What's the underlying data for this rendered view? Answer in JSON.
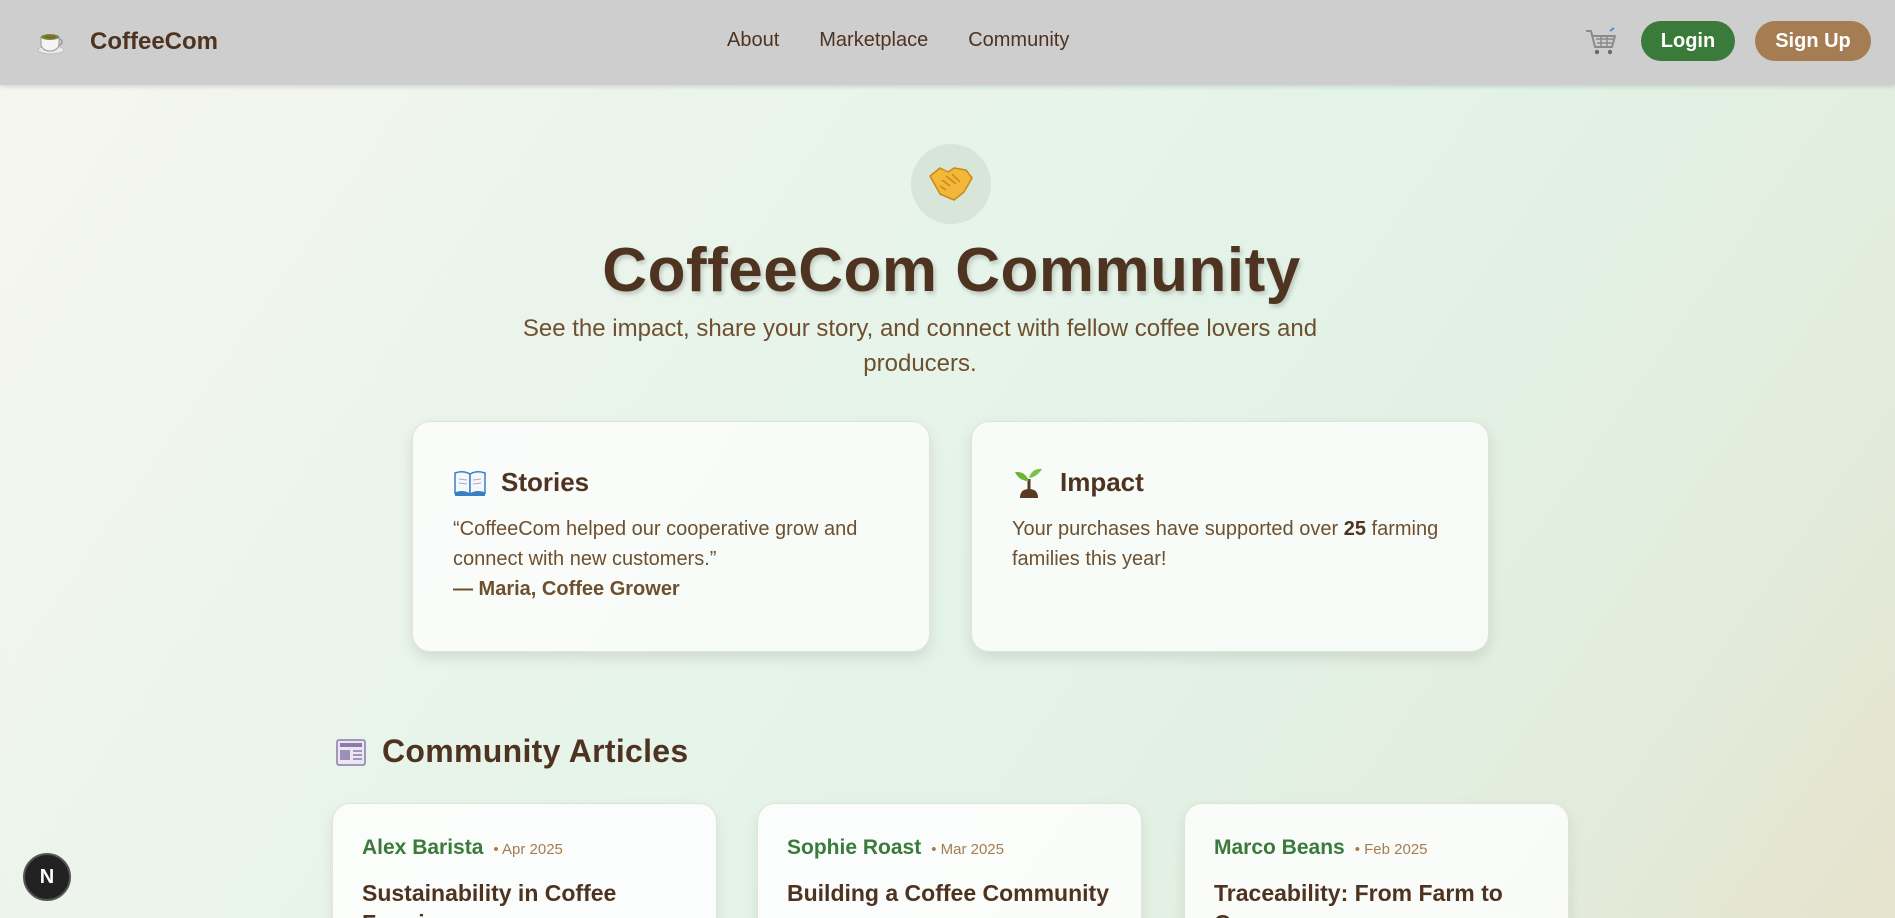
{
  "nav": {
    "brand": "CoffeeCom",
    "links": [
      "About",
      "Marketplace",
      "Community"
    ],
    "login": "Login",
    "signup": "Sign Up"
  },
  "hero": {
    "title": "CoffeeCom Community",
    "subtitle": "See the impact, share your story, and connect with fellow coffee lovers and producers."
  },
  "cards": {
    "stories": {
      "title": "Stories",
      "quote": "“CoffeeCom helped our cooperative grow and connect with new customers.”",
      "author": "— Maria, Coffee Grower"
    },
    "impact": {
      "title": "Impact",
      "text_before": "Your purchases have supported over ",
      "number": "25",
      "text_after": " farming families this year!"
    }
  },
  "articles": {
    "heading": "Community Articles",
    "items": [
      {
        "author": "Alex Barista",
        "date": "• Apr 2025",
        "title": "Sustainability in Coffee Farming"
      },
      {
        "author": "Sophie Roast",
        "date": "• Mar 2025",
        "title": "Building a Coffee Community"
      },
      {
        "author": "Marco Beans",
        "date": "• Feb 2025",
        "title": "Traceability: From Farm to Cup"
      }
    ]
  },
  "badge": {
    "letter": "N"
  },
  "icons": {
    "brand": "coffee-cup-icon",
    "cart": "cart-icon",
    "hero": "handshake-icon",
    "stories": "book-icon",
    "impact": "seedling-icon",
    "articles": "newspaper-icon"
  },
  "colors": {
    "primary_brown": "#4e3420",
    "green": "#3a7a3a",
    "tan": "#a67c52",
    "navbar": "#cecece"
  }
}
